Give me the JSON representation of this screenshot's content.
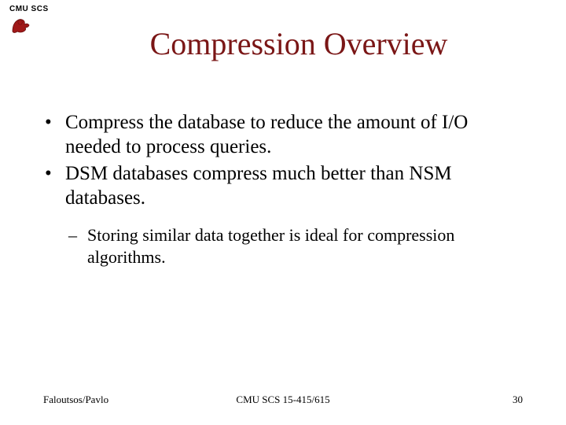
{
  "header": {
    "label": "CMU SCS"
  },
  "title": "Compression Overview",
  "bullets": [
    "Compress the database to reduce the amount of I/O needed to process queries.",
    "DSM databases compress much better than NSM databases."
  ],
  "subbullets": [
    "Storing similar data together is ideal for compression algorithms."
  ],
  "footer": {
    "left": "Faloutsos/Pavlo",
    "center": "CMU SCS 15-415/615",
    "right": "30"
  }
}
